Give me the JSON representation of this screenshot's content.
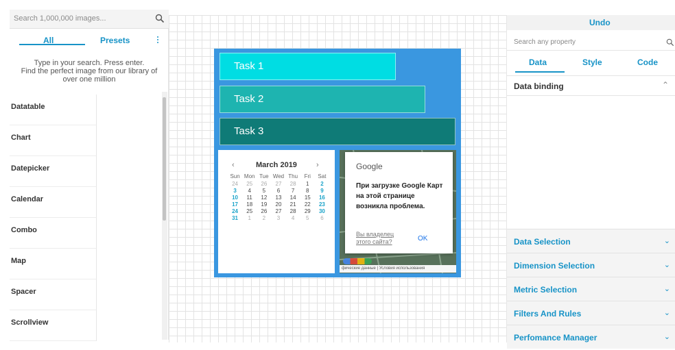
{
  "left": {
    "search_placeholder": "Search 1,000,000 images...",
    "tabs": {
      "all": "All",
      "presets": "Presets"
    },
    "hint": [
      "Type in your search. Press enter.",
      "Find the perfect image from our library of",
      "over one million"
    ],
    "widgets": [
      "Datatable",
      "Chart",
      "Datepicker",
      "Calendar",
      "Combo",
      "Map",
      "Spacer",
      "Scrollview"
    ]
  },
  "canvas": {
    "tasks": [
      "Task 1",
      "Task 2",
      "Task 3"
    ],
    "task_colors": [
      "#00dde3",
      "#1eb4b0",
      "#0f7b77"
    ],
    "board_color": "#3a97e0",
    "calendar": {
      "prev": "‹",
      "title": "March 2019",
      "next": "›",
      "dow": [
        "Sun",
        "Mon",
        "Tue",
        "Wed",
        "Thu",
        "Fri",
        "Sat"
      ],
      "days": [
        [
          "24",
          "25",
          "26",
          "27",
          "28",
          "1",
          "2"
        ],
        [
          "3",
          "4",
          "5",
          "6",
          "7",
          "8",
          "9"
        ],
        [
          "10",
          "11",
          "12",
          "13",
          "14",
          "15",
          "16"
        ],
        [
          "17",
          "18",
          "19",
          "20",
          "21",
          "22",
          "23"
        ],
        [
          "24",
          "25",
          "26",
          "27",
          "28",
          "29",
          "30"
        ],
        [
          "31",
          "1",
          "2",
          "3",
          "4",
          "5",
          "6"
        ]
      ]
    },
    "map_dialog": {
      "brand": "Google",
      "message": "При загрузке Google Карт на этой странице возникла проблема.",
      "owner_link": "Вы владелец этого сайта?",
      "ok": "OK",
      "footer": "фические данные | Условия использования"
    }
  },
  "right": {
    "undo": "Undo",
    "search_placeholder": "Search any property",
    "tabs": {
      "data": "Data",
      "style": "Style",
      "code": "Code"
    },
    "data_binding": "Data binding",
    "sections": [
      "Data Selection",
      "Dimension Selection",
      "Metric Selection",
      "Filters And Rules",
      "Perfomance Manager"
    ]
  },
  "colors": {
    "accent": "#1793c7"
  }
}
